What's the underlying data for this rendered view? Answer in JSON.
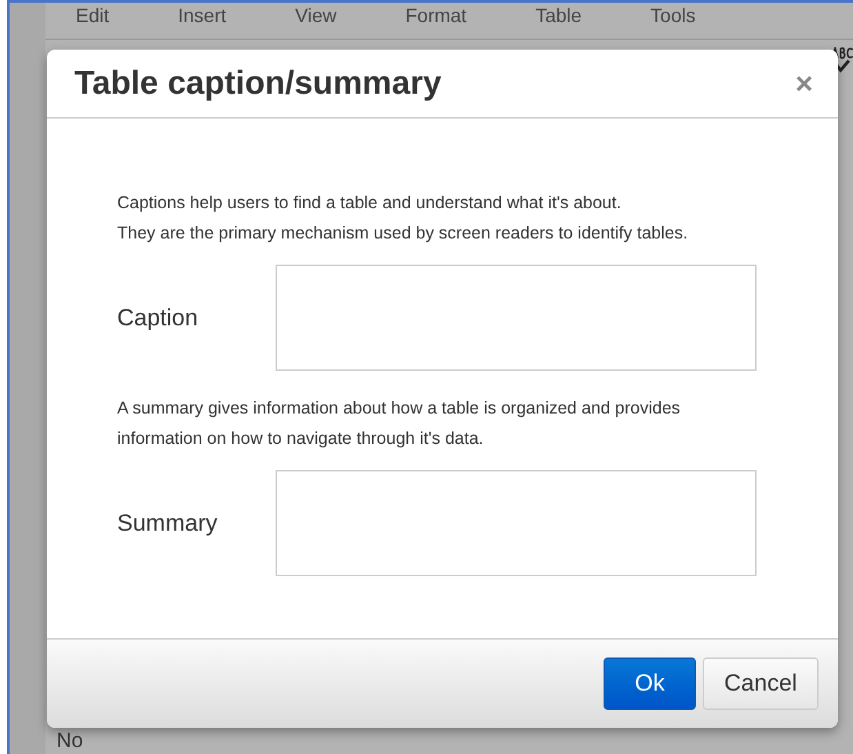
{
  "background": {
    "menu": [
      "Edit",
      "Insert",
      "View",
      "Format",
      "Table",
      "Tools"
    ],
    "footer_text": "No"
  },
  "dialog": {
    "title": "Table caption/summary",
    "close": "×",
    "sections": [
      {
        "description": [
          "Captions help users to find a table and understand what it's about.",
          "They are the primary mechanism used by screen readers to identify tables."
        ],
        "label": "Caption"
      },
      {
        "description": [
          "A summary gives information about how a table is organized and provides",
          "information on how to navigate through it's data."
        ],
        "label": "Summary"
      }
    ],
    "buttons": [
      {
        "label": "Ok",
        "kind": "primary"
      },
      {
        "label": "Cancel",
        "kind": "secondary"
      }
    ]
  }
}
